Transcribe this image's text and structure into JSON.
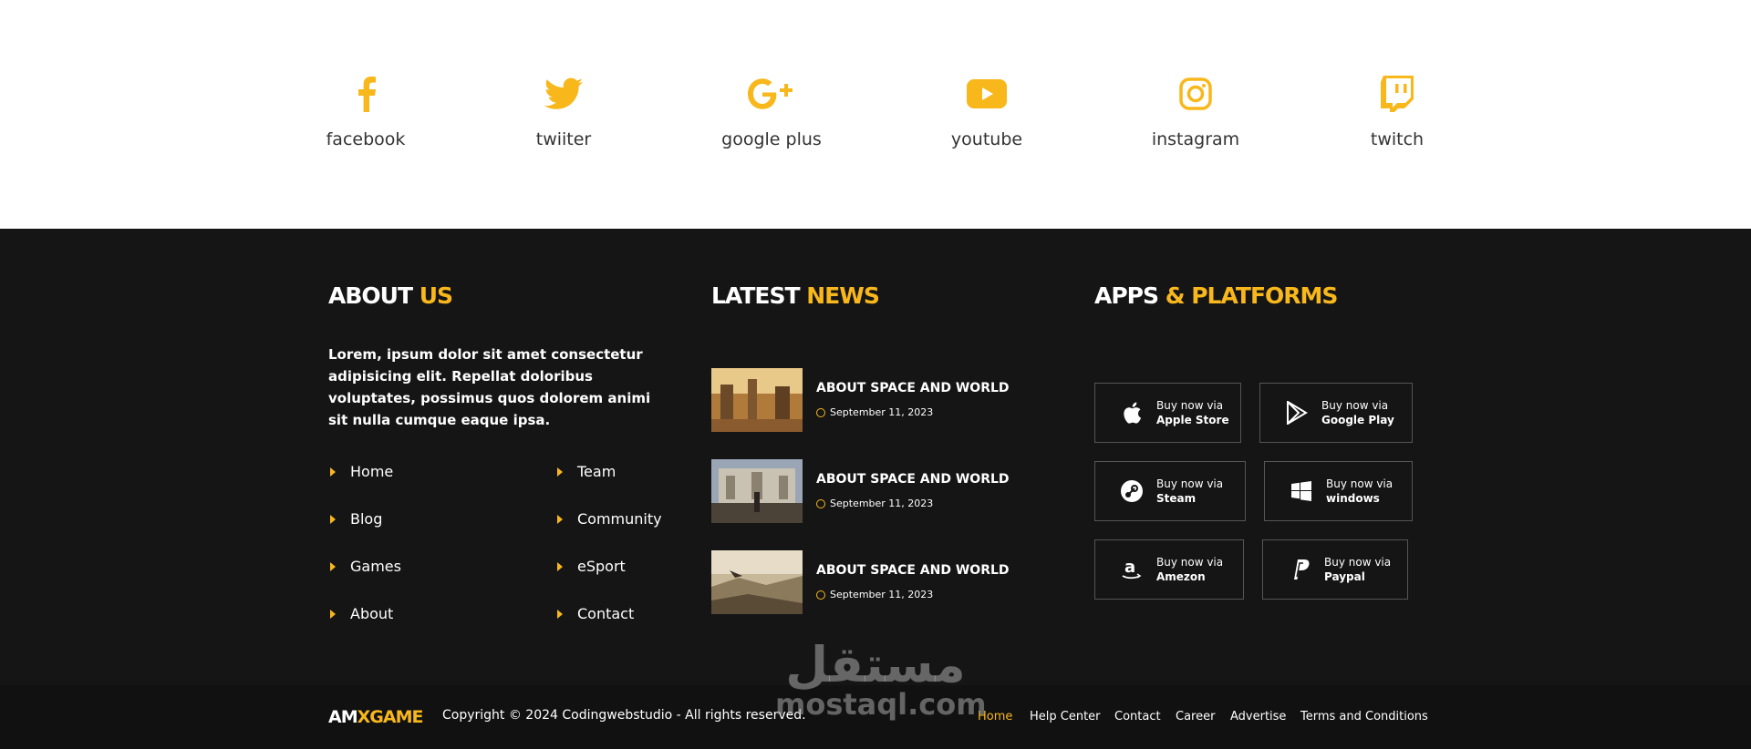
{
  "colors": {
    "accent": "#f8b71b",
    "footer_bg": "#151515",
    "line": "#d4a20e"
  },
  "social": [
    {
      "label": "facebook",
      "icon": "facebook-icon"
    },
    {
      "label": "twiiter",
      "icon": "twitter-icon"
    },
    {
      "label": "google plus",
      "icon": "google-plus-icon"
    },
    {
      "label": "youtube",
      "icon": "youtube-icon"
    },
    {
      "label": "instagram",
      "icon": "instagram-icon"
    },
    {
      "label": "twitch",
      "icon": "twitch-icon"
    }
  ],
  "about": {
    "heading_white": "ABOUT",
    "heading_yellow": "US",
    "text": "Lorem, ipsum dolor sit amet consectetur adipisicing elit. Repellat doloribus voluptates, possimus quos dolorem animi sit nulla cumque eaque ipsa.",
    "links_left": [
      "Home",
      "Blog",
      "Games",
      "About"
    ],
    "links_right": [
      "Team",
      "Community",
      "eSport",
      "Contact"
    ]
  },
  "news": {
    "heading_white": "LATEST",
    "heading_yellow": "NEWS",
    "items": [
      {
        "title": "ABOUT SPACE AND WORLD",
        "date": "September 11, 2023"
      },
      {
        "title": "ABOUT SPACE AND WORLD",
        "date": "September 11, 2023"
      },
      {
        "title": "ABOUT SPACE AND WORLD",
        "date": "September 11, 2023"
      }
    ]
  },
  "apps": {
    "heading_white": "APPS",
    "heading_yellow": "& PLATFORMS",
    "items": [
      {
        "line1": "Buy now via",
        "line2": "Apple Store",
        "icon": "apple-icon"
      },
      {
        "line1": "Buy now via",
        "line2": "Google Play",
        "icon": "google-play-icon"
      },
      {
        "line1": "Buy now via",
        "line2": "Steam",
        "icon": "steam-icon"
      },
      {
        "line1": "Buy now via",
        "line2": "windows",
        "icon": "windows-icon"
      },
      {
        "line1": "Buy now via",
        "line2": "Amezon",
        "icon": "amazon-icon"
      },
      {
        "line1": "Buy now via",
        "line2": "Paypal",
        "icon": "paypal-icon"
      }
    ]
  },
  "bottom": {
    "logo_white": "AM",
    "logo_yellow": "XGAME",
    "copyright": "Copyright © 2024 Codingwebstudio - All rights reserved.",
    "links": [
      "Home",
      "Help Center",
      "Contact",
      "Career",
      "Advertise",
      "Terms and Conditions"
    ]
  },
  "watermark": {
    "arabic": "مستقل",
    "latin": "mostaql.com"
  }
}
